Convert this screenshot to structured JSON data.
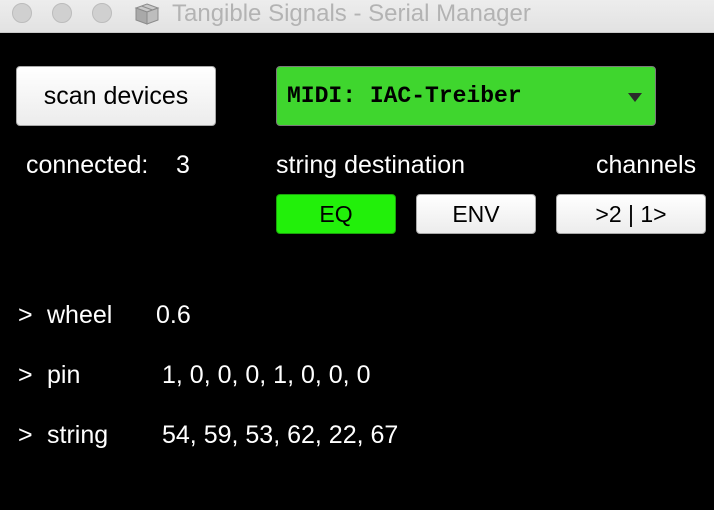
{
  "window": {
    "title": "Tangible Signals - Serial Manager",
    "app_icon": "package-icon"
  },
  "controls": {
    "scan_label": "scan devices",
    "midi_destination": {
      "selected": "MIDI: IAC-Treiber",
      "color": "#3fd62e"
    }
  },
  "status": {
    "connected_label": "connected:",
    "connected_count": "3",
    "string_destination_label": "string destination",
    "channels_label": "channels"
  },
  "toggles": {
    "eq": {
      "label": "EQ",
      "active": true,
      "color": "#22f00a"
    },
    "env": {
      "label": "ENV",
      "active": false
    },
    "channels": {
      "label": ">2 | 1>"
    }
  },
  "signals": [
    {
      "prompt": ">",
      "name": "wheel",
      "value": "0.6"
    },
    {
      "prompt": ">",
      "name": "pin",
      "value": "1, 0, 0, 0, 1, 0, 0, 0"
    },
    {
      "prompt": ">",
      "name": "string",
      "value": "54, 59, 53, 62, 22, 67"
    }
  ]
}
